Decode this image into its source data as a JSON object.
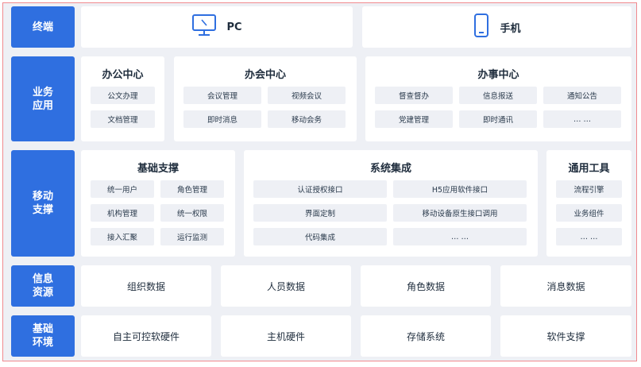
{
  "accent": "#2f6fe0",
  "layers": {
    "terminal": {
      "label": "终端",
      "pc": "PC",
      "phone": "手机"
    },
    "business": {
      "label": "业务\n应用",
      "office": {
        "title": "办公中心",
        "items": [
          "公文办理",
          "文档管理"
        ]
      },
      "meeting": {
        "title": "办会中心",
        "items": [
          "会议管理",
          "视频会议",
          "即时消息",
          "移动会务"
        ]
      },
      "affairs": {
        "title": "办事中心",
        "items": [
          "督查督办",
          "信息报送",
          "通知公告",
          "党建管理",
          "即时通讯",
          "… …"
        ]
      }
    },
    "mobile": {
      "label": "移动\n支撑",
      "base": {
        "title": "基础支撑",
        "items": [
          "统一用户",
          "角色管理",
          "机构管理",
          "统一权限",
          "接入汇聚",
          "运行监测"
        ]
      },
      "integration": {
        "title": "系统集成",
        "items": [
          "认证授权接口",
          "H5应用软件接口",
          "界面定制",
          "移动设备原生接口调用",
          "代码集成",
          "… …"
        ]
      },
      "tools": {
        "title": "通用工具",
        "items": [
          "流程引擎",
          "业务组件",
          "… …"
        ]
      }
    },
    "info": {
      "label": "信息\n资源",
      "items": [
        "组织数据",
        "人员数据",
        "角色数据",
        "消息数据"
      ]
    },
    "infra": {
      "label": "基础\n环境",
      "items": [
        "自主可控软硬件",
        "主机硬件",
        "存储系统",
        "软件支撑"
      ]
    }
  }
}
